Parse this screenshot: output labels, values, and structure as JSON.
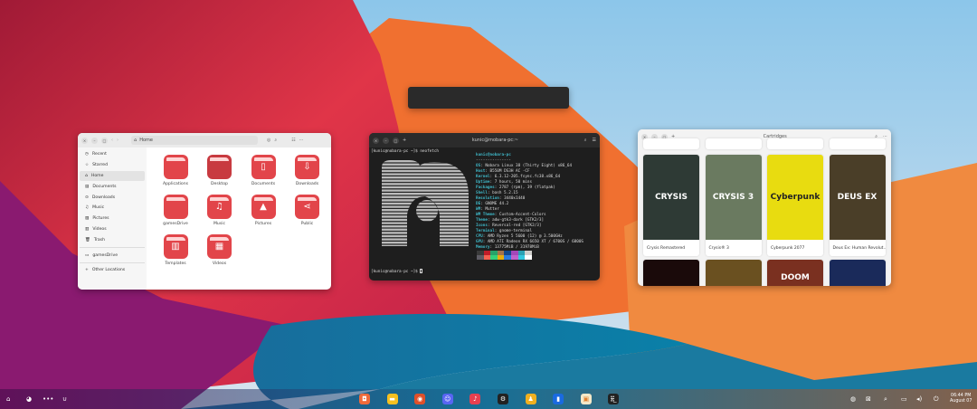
{
  "files": {
    "path": "Home",
    "sidebar": [
      "Recent",
      "Starred",
      "Home",
      "Documents",
      "Downloads",
      "Music",
      "Pictures",
      "Videos",
      "Trash",
      "gamesDrive",
      "Other Locations"
    ],
    "items": [
      "Applications",
      "Desktop",
      "Documents",
      "Downloads",
      "gamesDrive",
      "Music",
      "Pictures",
      "Public",
      "Templates",
      "Videos"
    ]
  },
  "terminal": {
    "title": "kunic@mobara-pc:~",
    "cmd": "[kunic@nobara-pc ~]$ neofetch",
    "prompt": "[kunic@nobara-pc ~]$ ",
    "header": "kunic@nobara-pc",
    "rule": "---------------",
    "info": [
      [
        "OS",
        "Nobara Linux 38 (Thirty Eight) x86_64"
      ],
      [
        "Host",
        "B550M DS3H AC -CF"
      ],
      [
        "Kernel",
        "6.3.12-205.fsync.fc38.x86_64"
      ],
      [
        "Uptime",
        "7 hours, 50 mins"
      ],
      [
        "Packages",
        "2787 (rpm), 39 (flatpak)"
      ],
      [
        "Shell",
        "bash 5.2.15"
      ],
      [
        "Resolution",
        "3440x1440"
      ],
      [
        "DE",
        "GNOME 44.2"
      ],
      [
        "WM",
        "Mutter"
      ],
      [
        "WM Theme",
        "Custom-Accent-Colors"
      ],
      [
        "Theme",
        "adw-gtk3-dark [GTK2/3]"
      ],
      [
        "Icons",
        "Reversal-red [GTK2/3]"
      ],
      [
        "Terminal",
        "gnome-terminal"
      ],
      [
        "CPU",
        "AMD Ryzen 5 5600 (12) @ 3.500GHz"
      ],
      [
        "GPU",
        "AMD ATI Radeon RX 6650 XT / 6700S / 6800S"
      ],
      [
        "Memory",
        "13775MiB / 31978MiB"
      ]
    ],
    "palette": [
      "#3a3a3a",
      "#c01c28",
      "#26a269",
      "#a2734c",
      "#12488b",
      "#a347ba",
      "#2aa1b3",
      "#d0cfcc",
      "#5e5c64",
      "#f66151",
      "#33d17a",
      "#e9ad0c",
      "#2a7bde",
      "#c061cb",
      "#33c7de",
      "#ffffff"
    ]
  },
  "cartridges": {
    "title": "Cartridges",
    "games": [
      {
        "name": "Crysis Remastered",
        "cover": "CRYSIS",
        "color": "#2e3a35"
      },
      {
        "name": "Crysis® 3",
        "cover": "CRYSIS 3",
        "color": "#6a7a60"
      },
      {
        "name": "Cyberpunk 2077",
        "cover": "Cyberpunk",
        "color": "#e8dc10"
      },
      {
        "name": "Deus Ex: Human Revolut...",
        "cover": "DEUS EX",
        "color": "#4a3e28"
      }
    ],
    "row2": [
      {
        "cover": "",
        "color": "#1a0a0a"
      },
      {
        "cover": "",
        "color": "#6a5020"
      },
      {
        "cover": "DOOM",
        "color": "#7a3020"
      },
      {
        "cover": "",
        "color": "#1a2a5a"
      }
    ]
  },
  "taskbar": {
    "clock": "06:44 PM",
    "date": "August 07",
    "apps": [
      {
        "name": "software",
        "color": "#f06a3a",
        "glyph": "◘"
      },
      {
        "name": "files",
        "color": "#f6c020",
        "glyph": "▬"
      },
      {
        "name": "firefox",
        "color": "#e0502a",
        "glyph": "◉"
      },
      {
        "name": "discord",
        "color": "#5865f2",
        "glyph": "☺"
      },
      {
        "name": "music",
        "color": "#e84050",
        "glyph": "♪"
      },
      {
        "name": "steam",
        "color": "#222",
        "glyph": "⚙"
      },
      {
        "name": "lutris",
        "color": "#f0b020",
        "glyph": "♟"
      },
      {
        "name": "trello",
        "color": "#1a6ae0",
        "glyph": "▮"
      },
      {
        "name": "cartridges",
        "color": "#f4e8c8",
        "glyph": "▣"
      },
      {
        "name": "terminal",
        "color": "#222",
        "glyph": "›_"
      }
    ]
  }
}
